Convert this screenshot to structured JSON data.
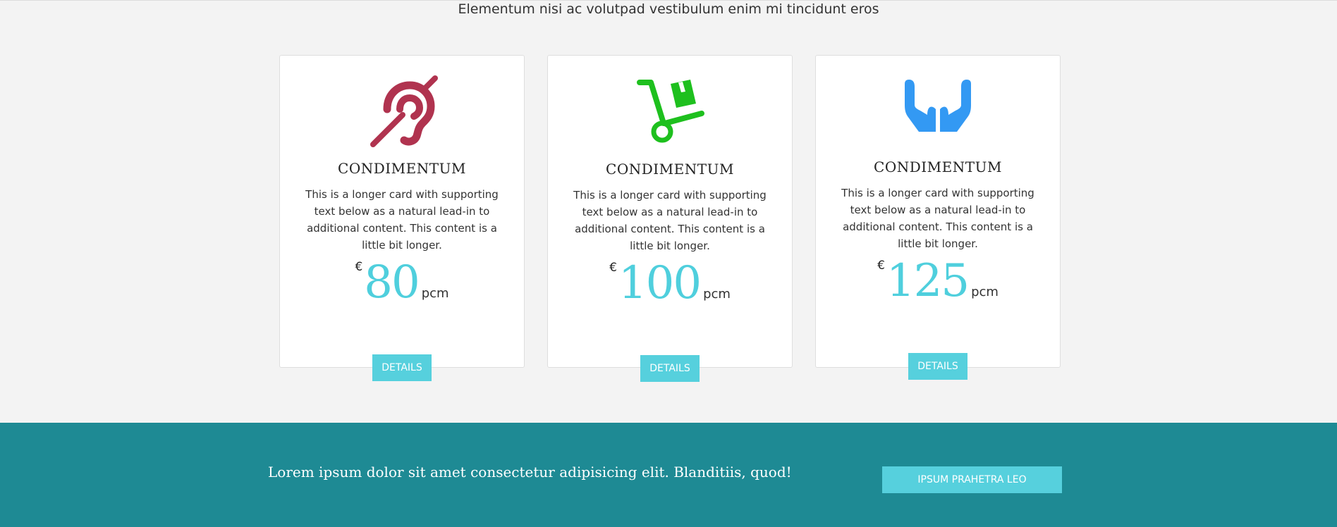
{
  "header": {
    "subtitle": "Elementum nisi ac volutpad vestibulum enim mi tincidunt eros"
  },
  "cards": [
    {
      "icon": "deaf-icon",
      "icon_color": "#b0334f",
      "title": "CONDIMENTUM",
      "text": "This is a longer card with supporting text below as a natural lead-in to additional content. This content is a little bit longer.",
      "currency": "€",
      "amount": "80",
      "period": "pcm",
      "button_label": "DETAILS"
    },
    {
      "icon": "dolly-icon",
      "icon_color": "#1ec01e",
      "title": "CONDIMENTUM",
      "text": "This is a longer card with supporting text below as a natural lead-in to additional content. This content is a little bit longer.",
      "currency": "€",
      "amount": "100",
      "period": "pcm",
      "button_label": "DETAILS"
    },
    {
      "icon": "hands-icon",
      "icon_color": "#3399f3",
      "title": "CONDIMENTUM",
      "text": "This is a longer card with supporting text below as a natural lead-in to additional content. This content is a little bit longer.",
      "currency": "€",
      "amount": "125",
      "period": "pcm",
      "button_label": "DETAILS"
    }
  ],
  "footer": {
    "text": "Lorem ipsum dolor sit amet consectetur adipisicing elit. Blanditiis, quod!",
    "button_label": "IPSUM PRAHETRA LEO",
    "background_color": "#1e8a94",
    "accent_color": "#56d0dd"
  }
}
